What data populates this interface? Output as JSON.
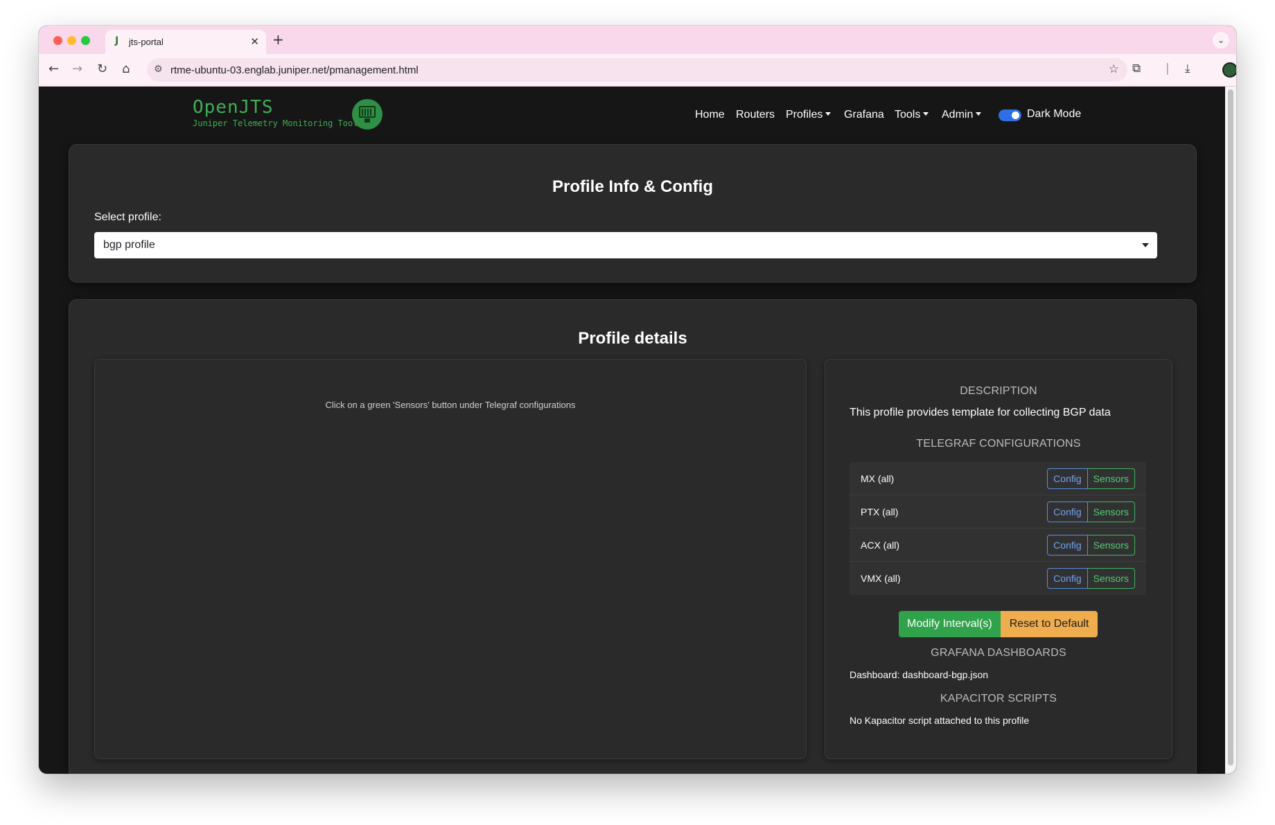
{
  "browser": {
    "tab_title": "jts-portal",
    "tab_favicon": "J",
    "new_tab": "+",
    "url": "rtme-ubuntu-03.englab.juniper.net/pmanagement.html"
  },
  "app": {
    "logo_title": "OpenJTS",
    "logo_subtitle": "Juniper Telemetry Monitoring Tool",
    "nav": {
      "home": "Home",
      "routers": "Routers",
      "profiles": "Profiles",
      "grafana": "Grafana",
      "tools": "Tools",
      "admin": "Admin"
    },
    "dark_mode_label": "Dark Mode",
    "dark_mode_on": true
  },
  "profile_info": {
    "title": "Profile Info & Config",
    "select_label": "Select profile:",
    "selected_profile": "bgp profile"
  },
  "profile_details": {
    "title": "Profile details",
    "hint": "Click on a green 'Sensors' button under Telegraf configurations",
    "description_heading": "DESCRIPTION",
    "description": "This profile provides template for collecting BGP data",
    "telegraf_heading": "TELEGRAF CONFIGURATIONS",
    "telegraf_configs": [
      {
        "name": "MX (all)",
        "config_label": "Config",
        "sensors_label": "Sensors"
      },
      {
        "name": "PTX (all)",
        "config_label": "Config",
        "sensors_label": "Sensors"
      },
      {
        "name": "ACX (all)",
        "config_label": "Config",
        "sensors_label": "Sensors"
      },
      {
        "name": "VMX (all)",
        "config_label": "Config",
        "sensors_label": "Sensors"
      }
    ],
    "modify_button": "Modify Interval(s)",
    "reset_button": "Reset to Default",
    "grafana_heading": "GRAFANA DASHBOARDS",
    "dashboard": "Dashboard: dashboard-bgp.json",
    "kapacitor_heading": "KAPACITOR SCRIPTS",
    "kapacitor": "No Kapacitor script attached to this profile"
  },
  "colors": {
    "brand_green": "#3fae55",
    "toggle_blue": "#2f6fe5",
    "modify_green": "#31a24c",
    "reset_orange": "#f0ad4e"
  }
}
